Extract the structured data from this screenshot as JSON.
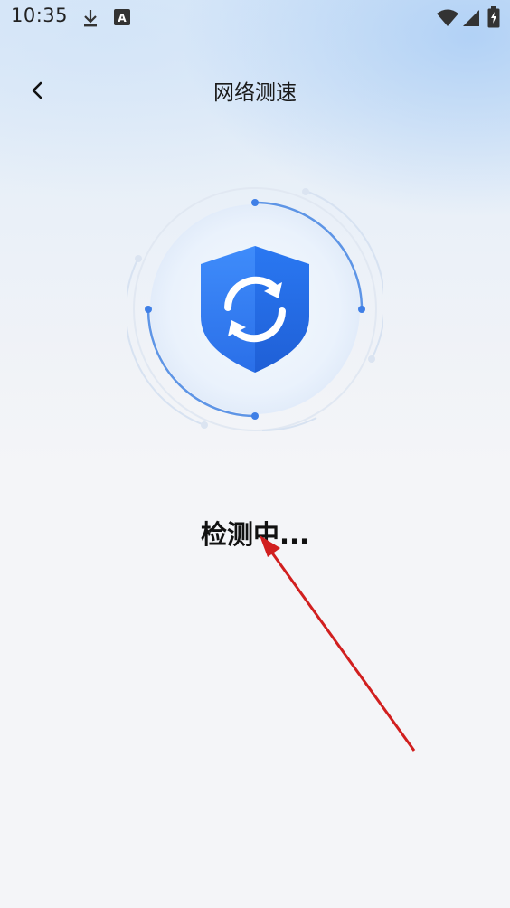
{
  "status_bar": {
    "time": "10:35",
    "icons": [
      "download-icon",
      "keyboard-a-icon",
      "wifi-icon",
      "signal-icon",
      "battery-charging-icon"
    ]
  },
  "header": {
    "back_icon": "chevron-left-icon",
    "title": "网络测速"
  },
  "scanner": {
    "icon": "shield-sync-icon",
    "accent_color": "#2f7cf6",
    "ring_color": "#5b93e8"
  },
  "status": {
    "text": "检测中..."
  },
  "annotation": {
    "arrow_color": "#d11f1f"
  }
}
